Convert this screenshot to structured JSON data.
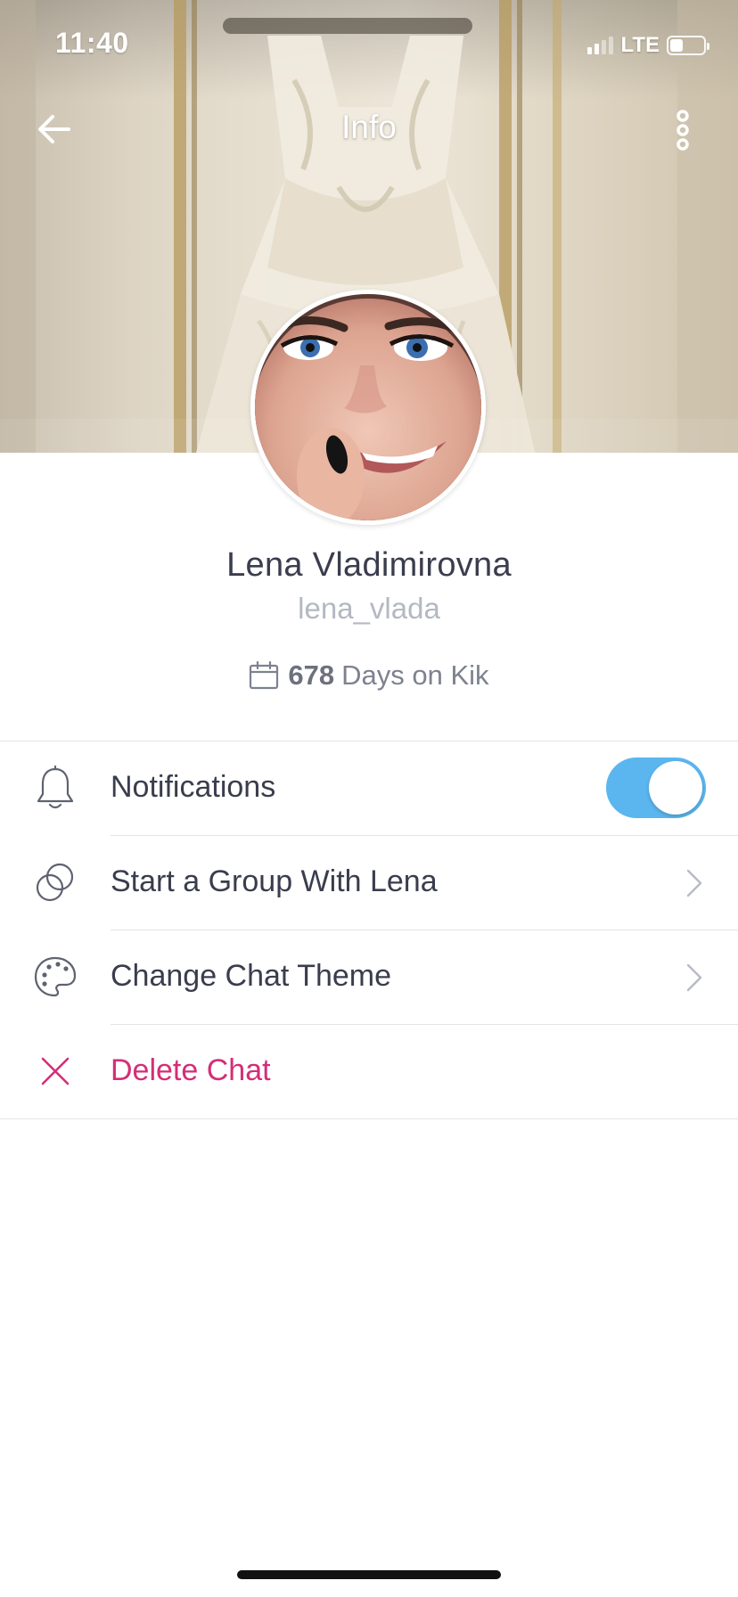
{
  "status_bar": {
    "time": "11:40",
    "network": "LTE",
    "signal_bars": 2,
    "battery_level": 0.4
  },
  "header": {
    "title": "Info",
    "back_icon": "arrow-left-icon",
    "more_icon": "vertical-ellipsis-icon"
  },
  "profile": {
    "name": "Lena Vladimirovna",
    "username": "lena_vlada",
    "days_count": "678",
    "days_label": "Days on Kik",
    "days_icon": "calendar-icon"
  },
  "menu": {
    "items": [
      {
        "label": "Notifications",
        "icon": "bell-icon",
        "control": "toggle",
        "enabled": true
      },
      {
        "label": "Start a Group With Lena",
        "icon": "group-circles-icon",
        "control": "chevron"
      },
      {
        "label": "Change Chat Theme",
        "icon": "palette-icon",
        "control": "chevron"
      },
      {
        "label": "Delete Chat",
        "icon": "close-icon",
        "control": "none",
        "danger": true
      }
    ]
  },
  "colors": {
    "accent": "#5bb6ef",
    "danger": "#d42e77",
    "text_primary": "#3a3d4d",
    "text_secondary": "#b4b8c2"
  }
}
